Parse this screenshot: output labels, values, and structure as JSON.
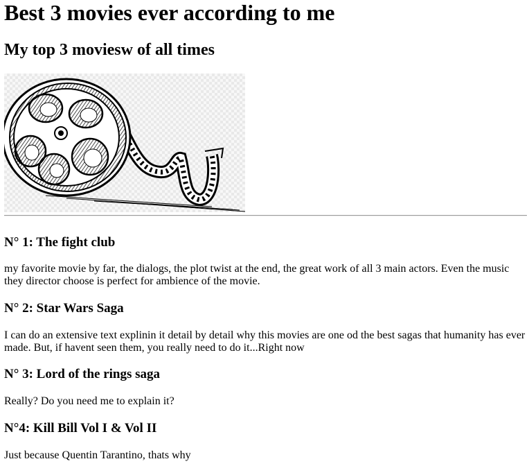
{
  "page": {
    "title": "Best 3 movies ever according to me",
    "subtitle": "My top 3 moviesw of all times"
  },
  "hero_image": {
    "icon": "film-reel-icon"
  },
  "movies": [
    {
      "heading": "N° 1: The fight club",
      "text": "my favorite movie by far, the dialogs, the plot twist at the end, the great work of all 3 main actors. Even the music they director choose is perfect for ambience of the movie."
    },
    {
      "heading": "N° 2: Star Wars Saga",
      "text": "I can do an extensive text explinin it detail by detail why this movies are one od the best sagas that humanity has ever made. But, if havent seen them, you really need to do it...Right now"
    },
    {
      "heading": "N° 3: Lord of the rings saga",
      "text": "Really? Do you need me to explain it?"
    },
    {
      "heading": "N°4: Kill Bill Vol I & Vol II",
      "text": "Just because Quentin Tarantino, thats why"
    }
  ]
}
